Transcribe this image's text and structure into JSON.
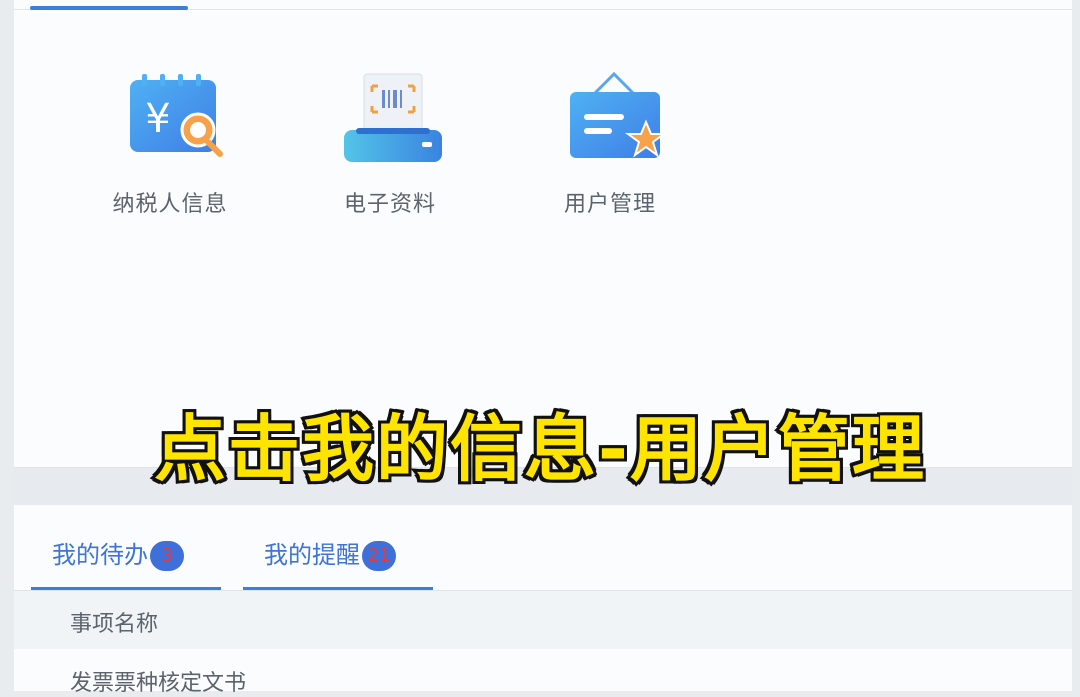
{
  "apps": [
    {
      "label": "纳税人信息",
      "icon": "taxpayer-info-icon"
    },
    {
      "label": "电子资料",
      "icon": "electronic-documents-icon"
    },
    {
      "label": "用户管理",
      "icon": "user-management-icon"
    }
  ],
  "caption": "点击我的信息-用户管理",
  "tabs": [
    {
      "label": "我的待办",
      "badge": "3"
    },
    {
      "label": "我的提醒",
      "badge": "21"
    }
  ],
  "table": {
    "header": "事项名称",
    "rows": [
      "发票票种核定文书"
    ]
  },
  "colors": {
    "accent": "#3d7edb",
    "caption_fill": "#ffe400",
    "badge": "#3f6fd8"
  }
}
